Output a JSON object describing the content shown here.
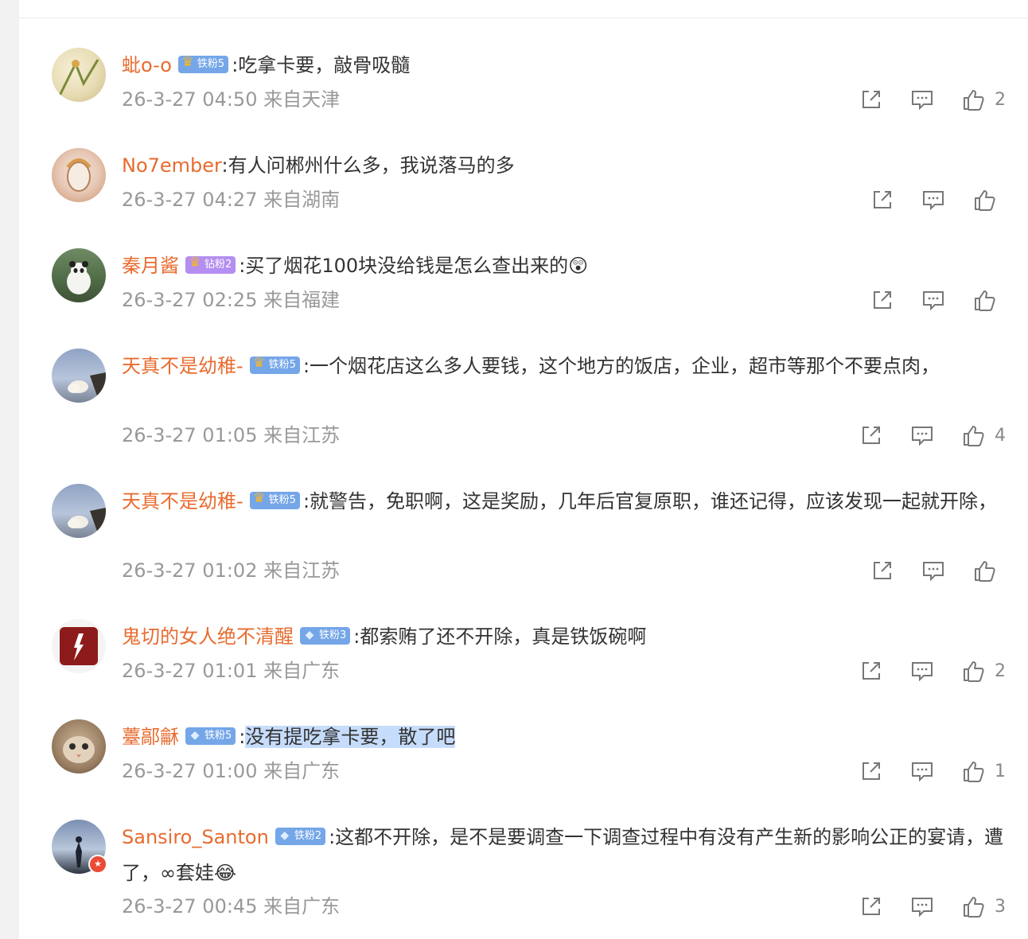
{
  "comments": [
    {
      "user": "蚍o-o",
      "badge": {
        "label": "铁粉5",
        "kind": "iron"
      },
      "text": "吃拿卡要，敲骨吸髓",
      "time": "26-3-27 04:50",
      "location": "来自天津",
      "likes": "2"
    },
    {
      "user": "No7ember",
      "badge": null,
      "text": "有人问郴州什么多，我说落马的多",
      "time": "26-3-27 04:27",
      "location": "来自湖南",
      "likes": ""
    },
    {
      "user": "秦月酱",
      "badge": {
        "label": "钻粉2",
        "kind": "diamond"
      },
      "text": "买了烟花100块没给钱是怎么查出来的😲",
      "time": "26-3-27 02:25",
      "location": "来自福建",
      "likes": ""
    },
    {
      "user": "天真不是幼稚-",
      "badge": {
        "label": "铁粉5",
        "kind": "iron"
      },
      "text": "一个烟花店这么多人要钱，这个地方的饭店，企业，超市等那个不要点肉，",
      "time": "26-3-27 01:05",
      "location": "来自江苏",
      "likes": "4"
    },
    {
      "user": "天真不是幼稚-",
      "badge": {
        "label": "铁粉5",
        "kind": "iron"
      },
      "text": "就警告，免职啊，这是奖励，几年后官复原职，谁还记得，应该发现一起就开除，",
      "time": "26-3-27 01:02",
      "location": "来自江苏",
      "likes": ""
    },
    {
      "user": "鬼切的女人绝不清醒",
      "badge": {
        "label": "铁粉3",
        "kind": "iron"
      },
      "text": "都索贿了还不开除，真是铁饭碗啊",
      "time": "26-3-27 01:01",
      "location": "来自广东",
      "likes": "2"
    },
    {
      "user": "薹鄗龢",
      "badge": {
        "label": "铁粉5",
        "kind": "iron"
      },
      "text": "没有提吃拿卡要，散了吧",
      "time": "26-3-27 01:00",
      "location": "来自广东",
      "likes": "1"
    },
    {
      "user": "Sansiro_Santon",
      "badge": {
        "label": "铁粉2",
        "kind": "iron"
      },
      "text": "这都不开除，是不是要调查一下调查过程中有没有产生新的影响公正的宴请，遭了，∞套娃😂",
      "time": "26-3-27 00:45",
      "location": "来自广东",
      "likes": "3"
    }
  ],
  "colors": {
    "username": "#e86b2f",
    "iron_badge": "#74a6e8",
    "diamond_badge": "#b48ef0",
    "selection": "#c6dcfb"
  },
  "icons": {
    "share": "share-icon",
    "comment": "comment-icon",
    "like": "thumb-up-icon"
  }
}
